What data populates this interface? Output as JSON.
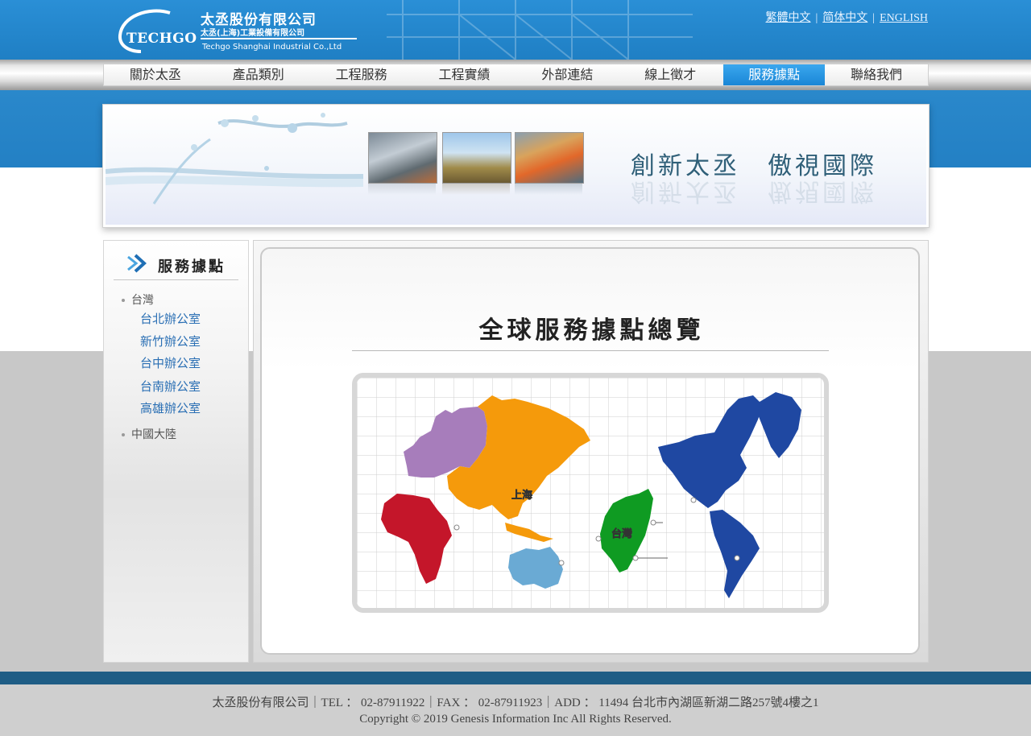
{
  "header": {
    "brand_en_logo": "TECHGO",
    "company_cn": "太丞股份有限公司",
    "company_cn_sub": "太丞(上海)工業設備有限公司",
    "company_en": "Techgo Shanghai Industrial Co.,Ltd",
    "languages": [
      "繁體中文",
      "简体中文",
      "ENGLISH"
    ],
    "lang_separator": "|"
  },
  "nav": {
    "items": [
      "關於太丞",
      "產品類別",
      "工程服務",
      "工程實績",
      "外部連結",
      "線上徵才",
      "服務據點",
      "聯絡我們"
    ],
    "active": "服務據點"
  },
  "banner": {
    "slogan": "創新太丞　傲視國際"
  },
  "sidebar": {
    "title": "服務據點",
    "groups": [
      {
        "label": "台灣",
        "links": [
          "台北辦公室",
          "新竹辦公室",
          "台中辦公室",
          "台南辦公室",
          "高雄辦公室"
        ]
      },
      {
        "label": "中國大陸",
        "links": []
      }
    ]
  },
  "main": {
    "title": "全球服務據點總覽",
    "map_labels": {
      "shanghai": "上海",
      "taiwan": "台灣"
    },
    "map_colors": {
      "europe": "#a77dbb",
      "asia": "#f59a0b",
      "africa": "#c4162a",
      "australia": "#6aaad4",
      "americas": "#1f48a2",
      "taiwan": "#0f9b22"
    }
  },
  "footer": {
    "line1": "太丞股份有限公司｜TEL ： 02-87911922｜FAX ： 02-87911923｜ADD ： 11494 台北市內湖區新湖二路257號4樓之1",
    "line2": "Copyright © 2019 Genesis Information Inc All Rights Reserved."
  },
  "colors": {
    "header_blue": "#2384c9",
    "nav_active": "#1a86d6",
    "link_blue": "#2a6fb4",
    "footer_bar": "#1f5d85"
  }
}
